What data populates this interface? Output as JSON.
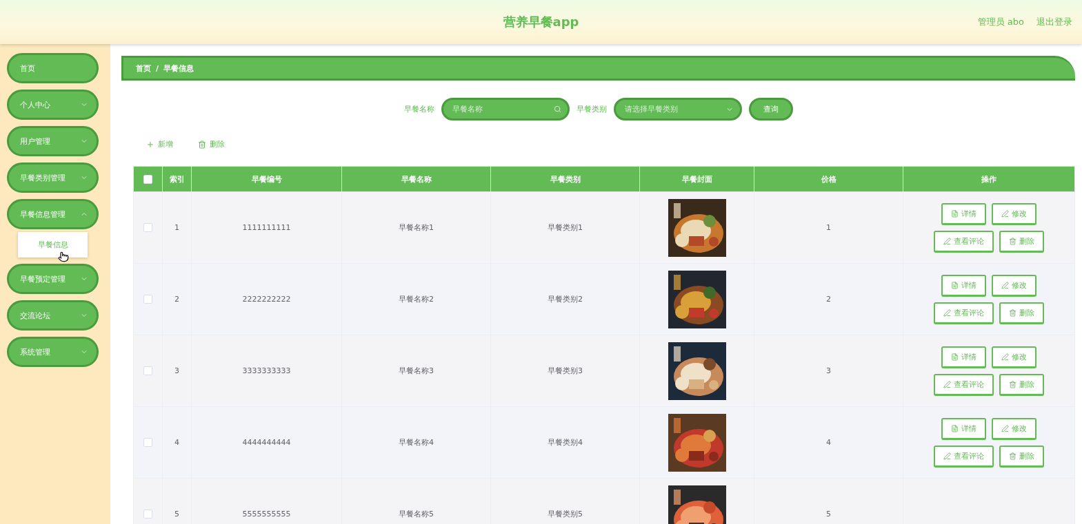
{
  "header": {
    "title": "营养早餐app",
    "user": "管理员 abo",
    "logout": "退出登录"
  },
  "sidebar": {
    "items": [
      {
        "label": "首页",
        "kind": "link"
      },
      {
        "label": "个人中心",
        "kind": "submenu",
        "expanded": false
      },
      {
        "label": "用户管理",
        "kind": "submenu",
        "expanded": false
      },
      {
        "label": "早餐类别管理",
        "kind": "submenu",
        "expanded": false
      },
      {
        "label": "早餐信息管理",
        "kind": "submenu",
        "expanded": true,
        "children": [
          {
            "label": "早餐信息",
            "selected": true
          }
        ]
      },
      {
        "label": "早餐预定管理",
        "kind": "submenu",
        "expanded": false
      },
      {
        "label": "交流论坛",
        "kind": "submenu",
        "expanded": false
      },
      {
        "label": "系统管理",
        "kind": "submenu",
        "expanded": false
      }
    ]
  },
  "breadcrumb": {
    "items": [
      "首页",
      "早餐信息"
    ],
    "separator": "/"
  },
  "search": {
    "fields": [
      {
        "label": "早餐名称",
        "placeholder": "早餐名称",
        "kind": "text"
      },
      {
        "label": "早餐类别",
        "placeholder": "请选择早餐类别",
        "kind": "select"
      }
    ],
    "button": "查询"
  },
  "toolbar": [
    {
      "label": "新增",
      "kind": "add"
    },
    {
      "label": "删除",
      "kind": "delete"
    }
  ],
  "table": {
    "select_all": false,
    "columns": [
      "索引",
      "早餐编号",
      "早餐名称",
      "早餐类别",
      "早餐封面",
      "价格",
      "操作"
    ],
    "rows": [
      {
        "checked": false,
        "index": "1",
        "code": "1111111111",
        "name": "早餐名称1",
        "category": "早餐类别1",
        "cover": {
          "kind": "picture"
        },
        "price": "1",
        "actions": [
          {
            "label": "详情",
            "kind": "detail"
          },
          {
            "label": "修改",
            "kind": "edit"
          },
          {
            "label": "查看评论",
            "kind": "comment"
          },
          {
            "label": "删除",
            "kind": "delete"
          }
        ]
      },
      {
        "checked": false,
        "index": "2",
        "code": "2222222222",
        "name": "早餐名称2",
        "category": "早餐类别2",
        "cover": {
          "kind": "picture"
        },
        "price": "2",
        "actions": [
          {
            "label": "详情",
            "kind": "detail"
          },
          {
            "label": "修改",
            "kind": "edit"
          },
          {
            "label": "查看评论",
            "kind": "comment"
          },
          {
            "label": "删除",
            "kind": "delete"
          }
        ]
      },
      {
        "checked": false,
        "index": "3",
        "code": "3333333333",
        "name": "早餐名称3",
        "category": "早餐类别3",
        "cover": {
          "kind": "picture"
        },
        "price": "3",
        "actions": [
          {
            "label": "详情",
            "kind": "detail"
          },
          {
            "label": "修改",
            "kind": "edit"
          },
          {
            "label": "查看评论",
            "kind": "comment"
          },
          {
            "label": "删除",
            "kind": "delete"
          }
        ]
      },
      {
        "checked": false,
        "index": "4",
        "code": "4444444444",
        "name": "早餐名称4",
        "category": "早餐类别4",
        "cover": {
          "kind": "picture"
        },
        "price": "4",
        "actions": [
          {
            "label": "详情",
            "kind": "detail"
          },
          {
            "label": "修改",
            "kind": "edit"
          },
          {
            "label": "查看评论",
            "kind": "comment"
          },
          {
            "label": "删除",
            "kind": "delete"
          }
        ]
      },
      {
        "checked": false,
        "index": "5",
        "code": "5555555555",
        "name": "早餐名称5",
        "category": "早餐类别5",
        "cover": {
          "kind": "picture"
        },
        "price": "5",
        "actions": []
      }
    ]
  }
}
